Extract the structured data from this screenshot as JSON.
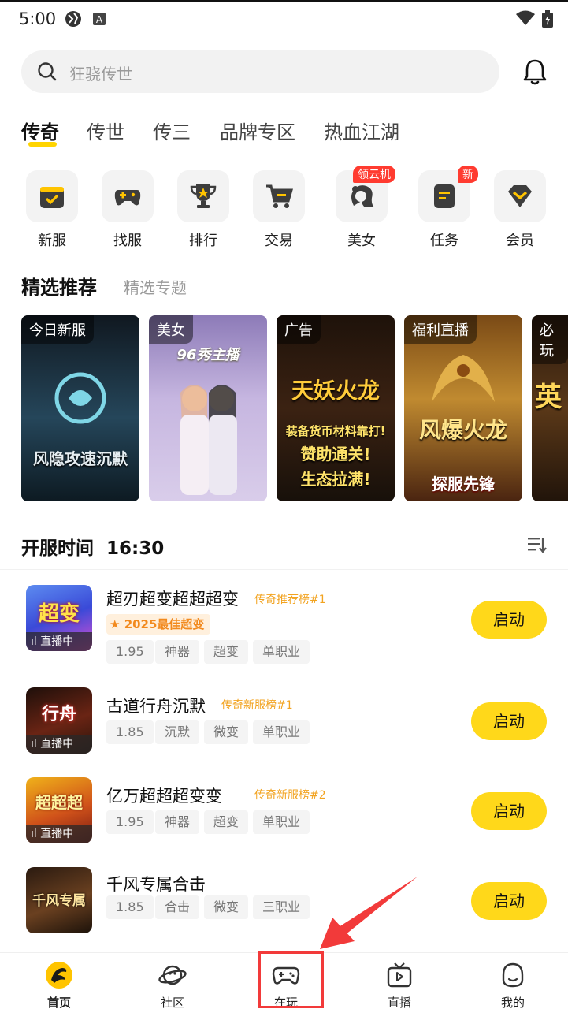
{
  "status_bar": {
    "time": "5:00",
    "icons": [
      "globe-icon",
      "a-icon",
      "wifi-icon",
      "battery-icon"
    ]
  },
  "search": {
    "placeholder": "狂骁传世"
  },
  "tabs": [
    "传奇",
    "传世",
    "传三",
    "品牌专区",
    "热血江湖"
  ],
  "quick_icons": [
    {
      "label": "新服",
      "icon": "calendar-check-icon"
    },
    {
      "label": "找服",
      "icon": "gamepad-icon"
    },
    {
      "label": "排行",
      "icon": "trophy-icon"
    },
    {
      "label": "交易",
      "icon": "cart-icon"
    },
    {
      "label": "美女",
      "icon": "girl-avatar-icon",
      "badge": "领云机"
    },
    {
      "label": "任务",
      "icon": "task-icon",
      "badge": "新"
    },
    {
      "label": "会员",
      "icon": "vip-icon"
    }
  ],
  "featured": {
    "title": "精选推荐",
    "subtitle": "精选专题"
  },
  "banners": [
    {
      "tag": "今日新服",
      "art_text": "风隐攻速沉默",
      "bg": "#1b2b33"
    },
    {
      "tag": "美女",
      "art_text": "96秀主播",
      "bg": "#b7a6d6"
    },
    {
      "tag": "广告",
      "art_text": "天妖火龙",
      "bg": "#2d1a0e",
      "lines": [
        "装备货币材料靠打!",
        "赞助通关!",
        "生态拉满!"
      ]
    },
    {
      "tag": "福利直播",
      "art_text": "风爆火龙",
      "bg": "#5a2c0f",
      "lines": [
        "探服先锋"
      ]
    },
    {
      "tag": "必玩",
      "art_text": "英",
      "bg": "#3a2412"
    }
  ],
  "server_list": {
    "title": "开服时间",
    "time": "16:30",
    "live_label": "直播中",
    "launch_label": "启动",
    "games": [
      {
        "name": "超刃超变超超超变",
        "rank": "传奇推荐榜#1",
        "award": "2025最佳超变",
        "tags": [
          "1.95",
          "神器",
          "超变",
          "单职业"
        ],
        "live": true,
        "thumb_text": "超变",
        "thumb_bg": "#3a58d8"
      },
      {
        "name": "古道行舟沉默",
        "rank": "传奇新服榜#1",
        "tags": [
          "1.85",
          "沉默",
          "微变",
          "单职业"
        ],
        "live": true,
        "thumb_text": "行舟",
        "thumb_bg": "#4a1a1a"
      },
      {
        "name": "亿万超超超变变",
        "rank": "传奇新服榜#2",
        "tags": [
          "1.95",
          "神器",
          "超变",
          "单职业"
        ],
        "live": true,
        "thumb_text": "超超超",
        "thumb_bg": "#d89a10"
      },
      {
        "name": "千风专属合击",
        "rank": "",
        "tags": [
          "1.85",
          "合击",
          "微变",
          "三职业"
        ],
        "live": false,
        "thumb_text": "千风专属",
        "thumb_bg": "#3b2414"
      }
    ]
  },
  "bottom_nav": [
    {
      "label": "首页",
      "icon": "home-dragon-icon"
    },
    {
      "label": "社区",
      "icon": "planet-icon"
    },
    {
      "label": "在玩",
      "icon": "gamepad-icon"
    },
    {
      "label": "直播",
      "icon": "tv-icon"
    },
    {
      "label": "我的",
      "icon": "user-icon"
    }
  ],
  "colors": {
    "accent": "#ffd81a",
    "highlight": "#f23a3a",
    "rank": "#f2a320"
  }
}
